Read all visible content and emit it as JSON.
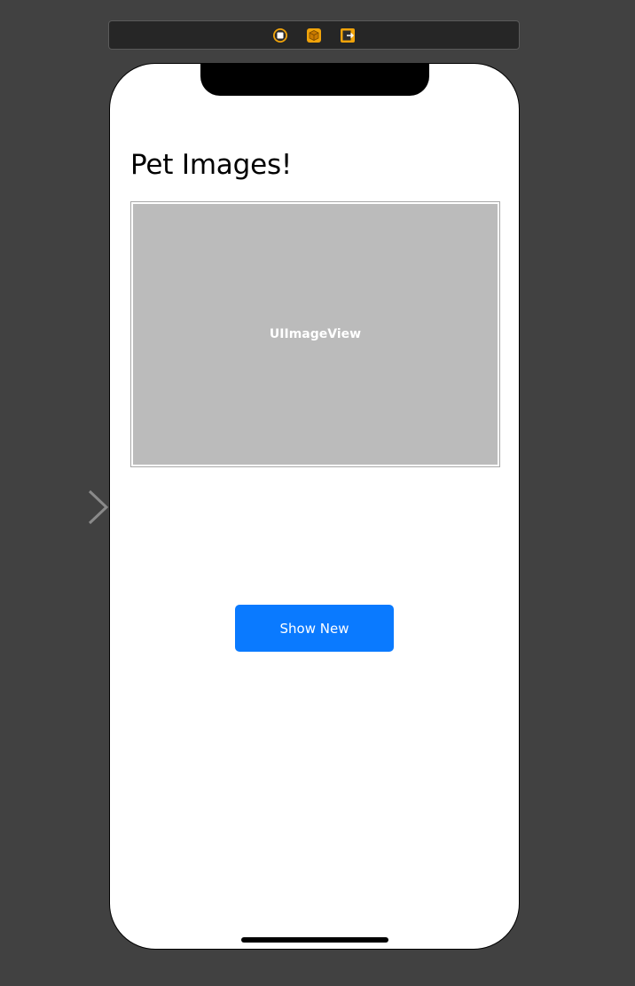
{
  "scene_dock": {
    "icons": [
      {
        "name": "view-controller-icon",
        "color": "#f0a30a"
      },
      {
        "name": "first-responder-icon",
        "color": "#f0a30a"
      },
      {
        "name": "exit-icon",
        "color": "#f0a30a"
      }
    ]
  },
  "view": {
    "title": "Pet Images!",
    "image_view_label": "UIImageView",
    "button_label": "Show New"
  },
  "colors": {
    "canvas": "#414141",
    "dock": "#262626",
    "accent": "#0a7aff",
    "image_placeholder": "#bbbbbb"
  }
}
